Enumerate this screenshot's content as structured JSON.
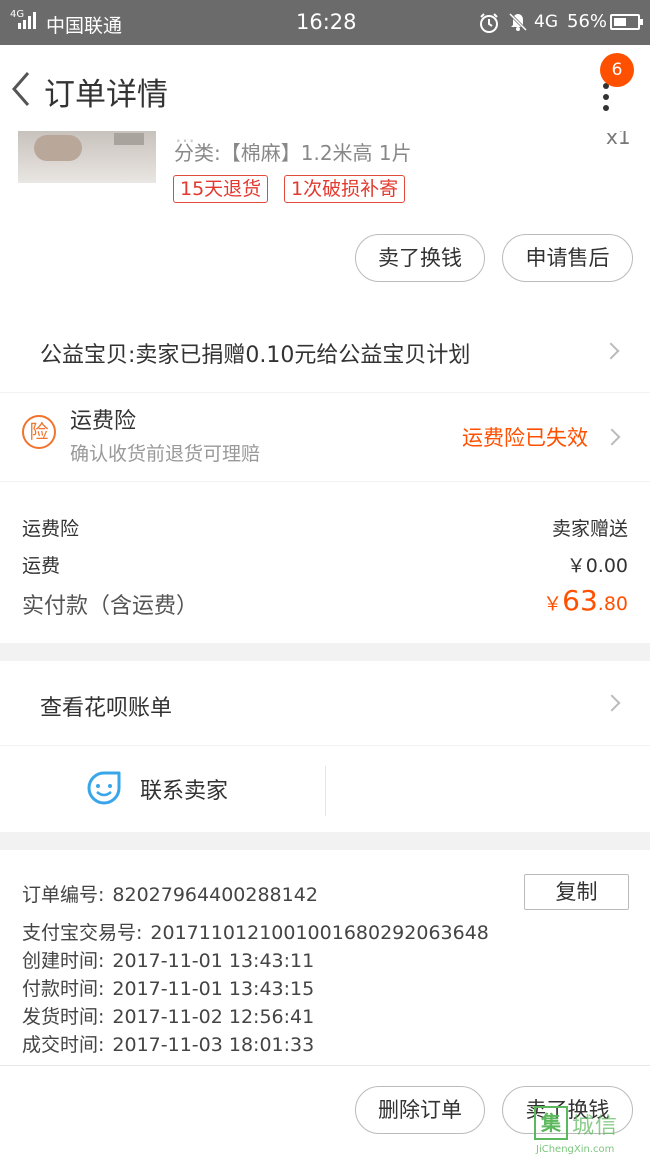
{
  "status_bar": {
    "signal": "4G",
    "carrier": "中国联通",
    "time": "16:28",
    "network": "4G",
    "battery": "56%",
    "battery_level": 0.56,
    "icons": [
      "signal-icon",
      "alarm-icon",
      "bell-muted-icon",
      "battery-icon"
    ]
  },
  "header": {
    "title": "订单详情",
    "badge": "6",
    "accent": "#ff5000",
    "icons": [
      "back-icon",
      "more-icon"
    ]
  },
  "goods": {
    "cut_text": "…",
    "sku": "分类:【棉麻】1.2米高 1片",
    "quantity": "x1",
    "tags": [
      "15天退货",
      "1次破损补寄"
    ],
    "btn_sell": "卖了换钱",
    "btn_aftersale": "申请售后"
  },
  "charity": {
    "label": "公益宝贝:卖家已捐赠0.10元给公益宝贝计划"
  },
  "insurance": {
    "icon_text": "险",
    "title": "运费险",
    "subtitle": "确认收货前退货可理赔",
    "status": "运费险已失效"
  },
  "fees": {
    "insurance_label": "运费险",
    "insurance_value": "卖家赠送",
    "shipping_label": "运费",
    "shipping_value": "￥0.00",
    "total_label": "实付款（含运费）",
    "total_currency": "￥",
    "total_int": "63",
    "total_dec": ".80"
  },
  "huabei": {
    "label": "查看花呗账单"
  },
  "contact": {
    "label": "联系卖家"
  },
  "order_info": {
    "order_no_label": "订单编号:",
    "order_no": "82027964400288142",
    "copy_label": "复制",
    "alipay_label": "支付宝交易号:",
    "alipay_no": "2017110121001001680292063648",
    "created_label": "创建时间:",
    "created": "2017-11-01 13:43:11",
    "paid_label": "付款时间:",
    "paid": "2017-11-01 13:43:15",
    "shipped_label": "发货时间:",
    "shipped": "2017-11-02 12:56:41",
    "done_label": "成交时间:",
    "done": "2017-11-03 18:01:33"
  },
  "footer": {
    "delete_label": "删除订单",
    "sell_label": "卖了换钱"
  },
  "watermark": {
    "box_char": "集",
    "cn": "城信",
    "en": "JiChengXin.com"
  }
}
